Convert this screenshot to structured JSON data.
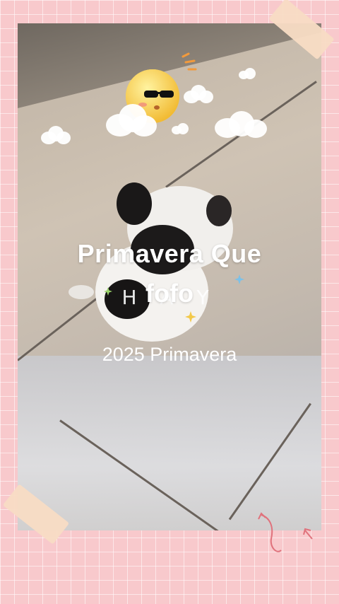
{
  "story": {
    "title": "Primavera Que",
    "decorative_text": "H  A Y",
    "highlight": "fofo",
    "year_caption": "2025 Primavera"
  },
  "stickers": {
    "sun": "sun-with-sunglasses-icon",
    "clouds": "cloud-icon",
    "stars": "star-icon",
    "arrows": "arrow-doodle-icon"
  },
  "colors": {
    "background": "#f8c9cc",
    "text": "#ffffff",
    "tape": "#f8dcc4",
    "sun": "#f7d248",
    "star_yellow": "#f3c94a",
    "star_green": "#9bd36b",
    "star_blue": "#7cc1e8",
    "doodle": "#e0727c"
  }
}
